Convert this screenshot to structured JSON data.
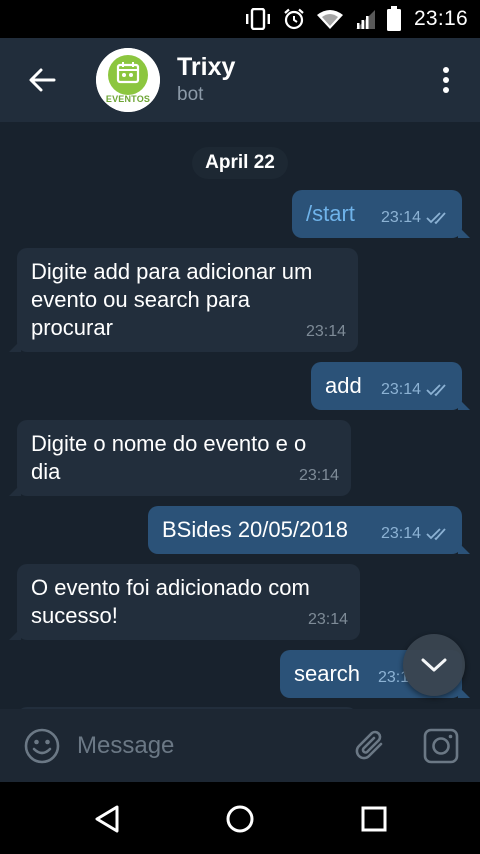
{
  "status_bar": {
    "time": "23:16",
    "icons": [
      "vibrate-icon",
      "alarm-icon",
      "wifi-icon",
      "signal-icon",
      "battery-icon"
    ]
  },
  "header": {
    "title": "Trixy",
    "subtitle": "bot",
    "avatar_text": "EVENTOS",
    "colors": {
      "background": "#212d3b",
      "avatar_green": "#8cc63f"
    }
  },
  "chat": {
    "date_label": "April 22",
    "colors": {
      "background": "#18222d",
      "incoming": "#222e3c",
      "outgoing": "#2b5278",
      "command": "#6fb3ea"
    },
    "messages": [
      {
        "direction": "out",
        "text": "/start",
        "time": "23:14",
        "status": "read"
      },
      {
        "direction": "in",
        "lines": [
          "Digite add para adicionar um",
          "evento ou search para",
          "procurar"
        ],
        "time": "23:14"
      },
      {
        "direction": "out",
        "text": "add",
        "time": "23:14",
        "status": "read"
      },
      {
        "direction": "in",
        "lines": [
          "Digite o nome do evento e o",
          "dia"
        ],
        "time": "23:14"
      },
      {
        "direction": "out",
        "text": "BSides 20/05/2018",
        "time": "23:14",
        "status": "read"
      },
      {
        "direction": "in",
        "lines": [
          "O evento foi adicionado com",
          "sucesso!"
        ],
        "time": "23:14"
      },
      {
        "direction": "out",
        "text": "search",
        "time": "23:1",
        "status": "read"
      }
    ]
  },
  "composer": {
    "placeholder": "Message"
  },
  "nav_bar": {
    "buttons": [
      "back-nav-icon",
      "home-icon",
      "recents-icon"
    ]
  }
}
